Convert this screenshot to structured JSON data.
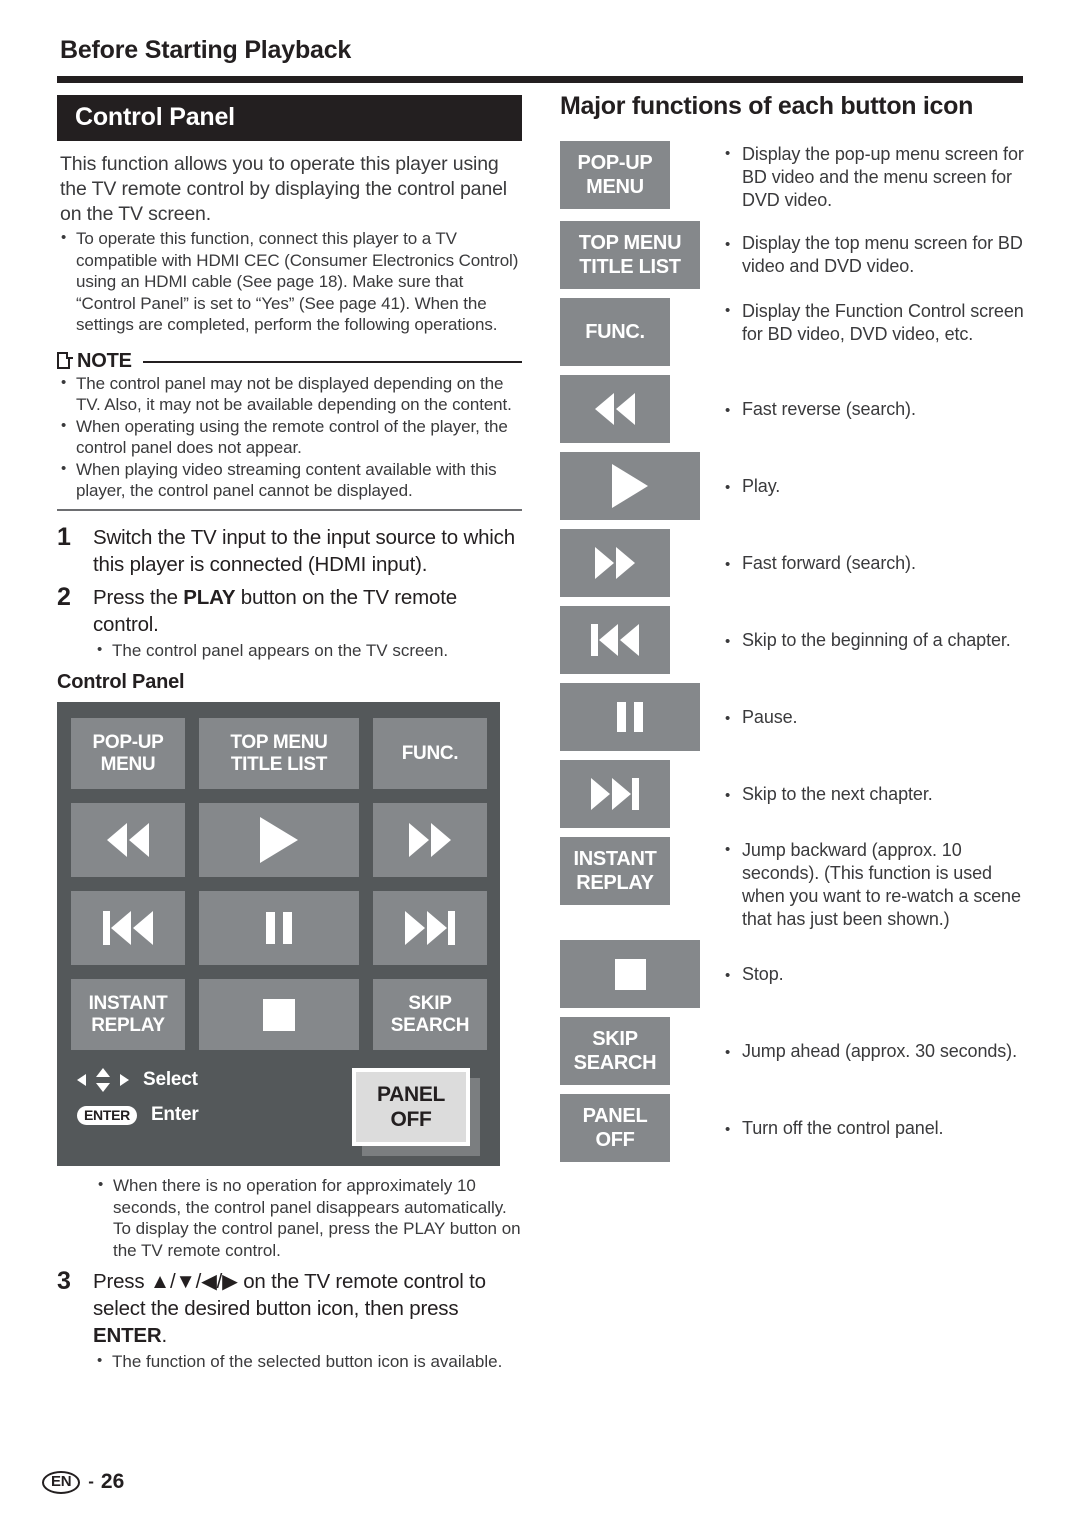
{
  "header": {
    "running_head": "Before Starting Playback"
  },
  "left": {
    "section_title": "Control Panel",
    "intro": "This function allows you to operate this player using the TV remote control by displaying the control panel on the TV screen.",
    "intro_bullets": [
      "To operate this function, connect this player to a TV compatible with HDMI CEC (Consumer Electronics Control) using an HDMI cable (See page 18). Make sure that “Control Panel” is set to “Yes” (See page 41). When the settings are completed, perform the following operations."
    ],
    "note": {
      "label": "NOTE",
      "bullets": [
        "The control panel may not be displayed depending on the TV. Also, it may not be available depending on the content.",
        "When operating using the remote control of the player, the control panel does not appear.",
        "When playing video streaming content available with this player, the control panel cannot be displayed."
      ]
    },
    "steps": [
      {
        "num": "1",
        "text": "Switch the TV input to the input source to which this player is connected (HDMI input).",
        "bullets": []
      },
      {
        "num": "2",
        "text": "Press the PLAY button on the TV remote control.",
        "text_pre": "Press the ",
        "text_bold": "PLAY",
        "text_post": " button on the TV remote control.",
        "bullets": [
          "The control panel appears on the TV screen."
        ]
      }
    ],
    "control_panel_caption": "Control Panel",
    "control_panel": {
      "buttons": [
        {
          "label": "POP-UP\nMENU",
          "line1": "POP-UP",
          "line2": "MENU",
          "icon": "none"
        },
        {
          "label": "TOP MENU\nTITLE LIST",
          "line1": "TOP MENU",
          "line2": "TITLE LIST",
          "icon": "none"
        },
        {
          "label": "FUNC.",
          "line1": "FUNC.",
          "line2": "",
          "icon": "none"
        },
        {
          "label": "",
          "icon": "fast-reverse"
        },
        {
          "label": "",
          "icon": "play"
        },
        {
          "label": "",
          "icon": "fast-forward"
        },
        {
          "label": "",
          "icon": "skip-previous"
        },
        {
          "label": "",
          "icon": "pause"
        },
        {
          "label": "",
          "icon": "skip-next"
        },
        {
          "label": "INSTANT\nREPLAY",
          "line1": "INSTANT",
          "line2": "REPLAY",
          "icon": "none"
        },
        {
          "label": "",
          "icon": "stop"
        },
        {
          "label": "SKIP\nSEARCH",
          "line1": "SKIP",
          "line2": "SEARCH",
          "icon": "none"
        }
      ],
      "legend": {
        "select_label": "Select",
        "enter_badge": "ENTER",
        "enter_label": "Enter"
      },
      "selected_button": {
        "line1": "PANEL",
        "line2": "OFF",
        "state": "selected"
      }
    },
    "after_panel_bullets": [
      "When there is no operation for approximately 10 seconds, the control panel disappears automatically. To display the control panel, press the PLAY button on the TV remote control."
    ],
    "step3": {
      "num": "3",
      "text_pre": "Press ",
      "arrows": "▲/▼/◀/▶",
      "text_mid": " on the TV remote control to select the desired button icon, then press ",
      "text_bold": "ENTER",
      "text_post": ".",
      "bullets": [
        "The function of the selected button icon is available."
      ]
    }
  },
  "right": {
    "title": "Major functions of each button icon",
    "rows": [
      {
        "icon": "none",
        "line1": "POP-UP",
        "line2": "MENU",
        "width": "narrow",
        "desc": "Display the pop-up menu screen for BD video and the menu screen for DVD video."
      },
      {
        "icon": "none",
        "line1": "TOP MENU",
        "line2": "TITLE LIST",
        "width": "wide",
        "desc": "Display the top menu screen for BD video and DVD video."
      },
      {
        "icon": "none",
        "line1": "FUNC.",
        "line2": "",
        "width": "narrow",
        "desc": "Display the Function Control screen for BD video, DVD video, etc."
      },
      {
        "icon": "fast-reverse",
        "line1": "",
        "line2": "",
        "width": "narrow",
        "desc": "Fast reverse (search)."
      },
      {
        "icon": "play",
        "line1": "",
        "line2": "",
        "width": "wide",
        "desc": "Play."
      },
      {
        "icon": "fast-forward",
        "line1": "",
        "line2": "",
        "width": "narrow",
        "desc": "Fast forward (search)."
      },
      {
        "icon": "skip-previous",
        "line1": "",
        "line2": "",
        "width": "narrow",
        "desc": "Skip to the beginning of a chapter."
      },
      {
        "icon": "pause",
        "line1": "",
        "line2": "",
        "width": "wide",
        "desc": "Pause."
      },
      {
        "icon": "skip-next",
        "line1": "",
        "line2": "",
        "width": "narrow",
        "desc": "Skip to the next chapter."
      },
      {
        "icon": "none",
        "line1": "INSTANT",
        "line2": "REPLAY",
        "width": "narrow",
        "desc": "Jump backward (approx. 10 seconds). (This function is used when you want to re-watch a scene that has just been shown.)"
      },
      {
        "icon": "stop",
        "line1": "",
        "line2": "",
        "width": "wide",
        "desc": "Stop."
      },
      {
        "icon": "none",
        "line1": "SKIP",
        "line2": "SEARCH",
        "width": "narrow",
        "desc": "Jump ahead (approx. 30 seconds)."
      },
      {
        "icon": "none",
        "line1": "PANEL",
        "line2": "OFF",
        "width": "narrow",
        "desc": "Turn off the control panel."
      }
    ]
  },
  "footer": {
    "lang_code": "EN",
    "dash": "-",
    "page_number": "26"
  },
  "colors": {
    "panel_bg": "#54585a",
    "button_bg": "#85888b",
    "selected_face": "#dcdcdc",
    "ink": "#231f20",
    "body_gray": "#3a3a3c"
  }
}
